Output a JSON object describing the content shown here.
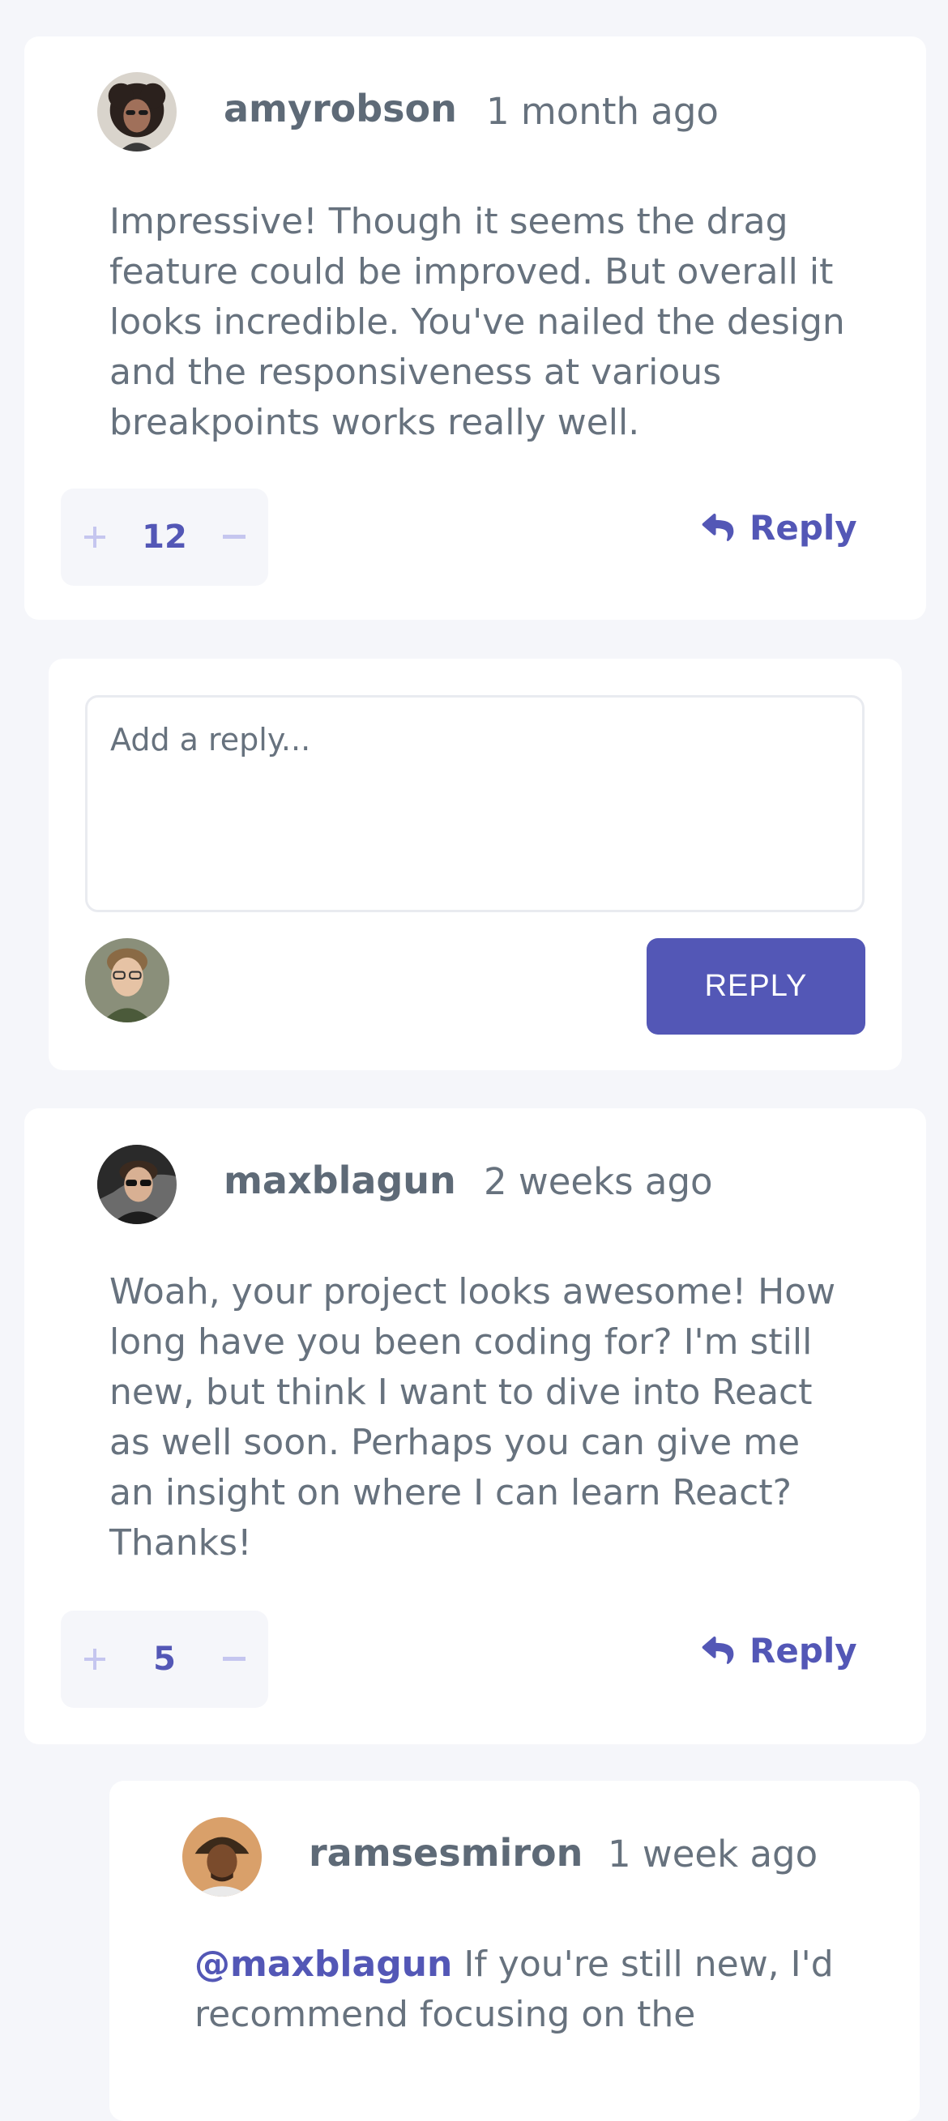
{
  "colors": {
    "accent": "#5357b6",
    "muted_accent": "#c5c6ef",
    "page_bg": "#f5f6fa"
  },
  "comments": [
    {
      "username": "amyrobson",
      "timestamp": "1 month ago",
      "body": "Impressive! Though it seems the drag feature could be improved. But overall it looks incredible. You've nailed the design and the responsiveness at various breakpoints works really well.",
      "score": "12",
      "reply_label": "Reply"
    },
    {
      "username": "maxblagun",
      "timestamp": "2 weeks ago",
      "body": "Woah, your project looks awesome! How long have you been coding for? I'm still new, but think I want to dive into React as well soon. Perhaps you can give me an insight on where I can learn React? Thanks!",
      "score": "5",
      "reply_label": "Reply"
    }
  ],
  "reply_form": {
    "placeholder": "Add a reply...",
    "value": "",
    "submit_label": "REPLY"
  },
  "nested_reply": {
    "username": "ramsesmiron",
    "timestamp": "1 week ago",
    "mention": "@maxblagun",
    "body": " If you're still new, I'd recommend focusing on the"
  },
  "icons": {
    "upvote": "plus-icon",
    "downvote": "minus-icon",
    "reply": "reply-arrow-icon"
  }
}
